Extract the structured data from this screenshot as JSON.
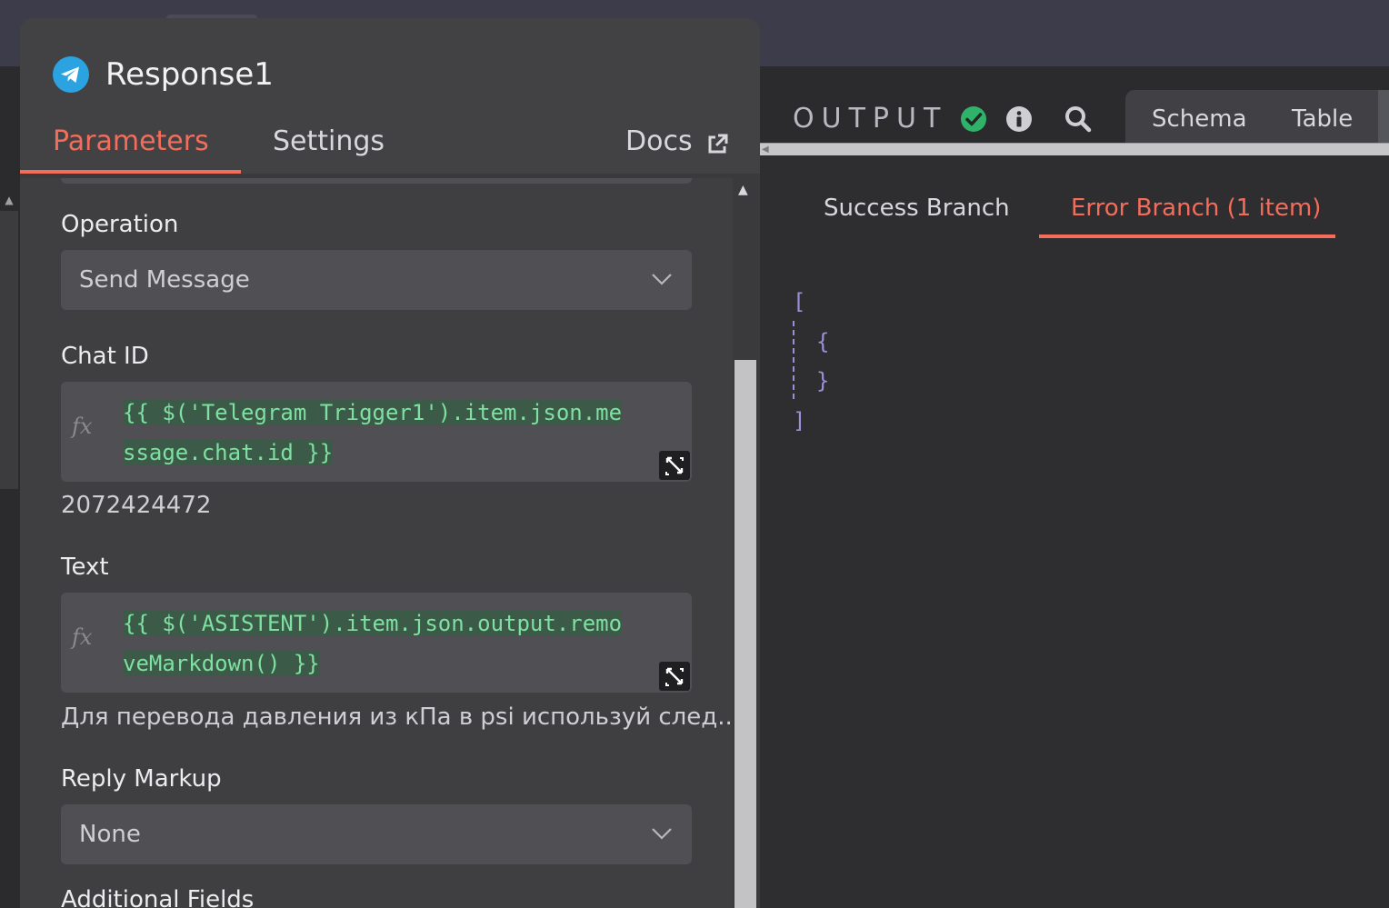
{
  "node": {
    "title": "Response1",
    "icon": "telegram-icon",
    "tabs": {
      "parameters": "Parameters",
      "settings": "Settings",
      "docs": "Docs"
    }
  },
  "form": {
    "operation": {
      "label": "Operation",
      "value": "Send Message"
    },
    "chat_id": {
      "label": "Chat ID",
      "expression_line1": "{{ $('Telegram Trigger1').item.json.me",
      "expression_line2": "ssage.chat.id }}",
      "resolved": "2072424472"
    },
    "text": {
      "label": "Text",
      "expression_line1": "{{ $('ASISTENT').item.json.output.remo",
      "expression_line2": "veMarkdown() }}",
      "resolved": "Для перевода давления из кПа в psi используй след..."
    },
    "reply_markup": {
      "label": "Reply Markup",
      "value": "None"
    },
    "additional_fields": {
      "label": "Additional Fields"
    }
  },
  "output": {
    "title": "OUTPUT",
    "view_tabs": {
      "schema": "Schema",
      "table": "Table"
    },
    "branches": {
      "success": "Success Branch",
      "error": "Error Branch (1 item)"
    },
    "json": {
      "open_bracket": "[",
      "open_brace": "{",
      "close_brace": "}",
      "close_bracket": "]"
    }
  },
  "colors": {
    "accent": "#f46d5b",
    "success": "#2fb36a",
    "expression": "#7ee0a1",
    "json": "#9b8fd9",
    "telegram": "#2aa3e0"
  }
}
